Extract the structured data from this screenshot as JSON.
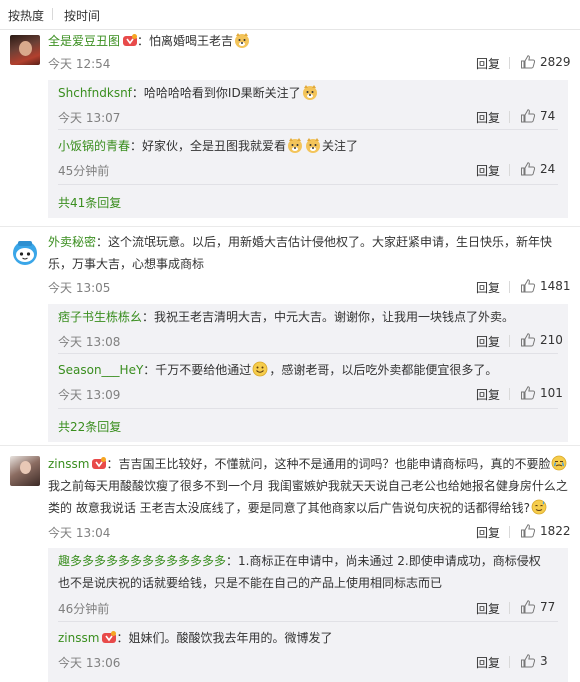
{
  "tabs": {
    "hot": "按热度",
    "time": "按时间"
  },
  "actions": {
    "reply": "回复"
  },
  "c1": {
    "user": "全是爱豆丑图",
    "text": "：怕离婚喝王老吉",
    "time": "今天 12:54",
    "likes": "2829",
    "replies": [
      {
        "user": "Shchfndksnf",
        "text": "：哈哈哈哈看到你ID果断关注了",
        "time": "今天 13:07",
        "likes": "74"
      },
      {
        "user": "小饭锅的青春",
        "text": "：好家伙，全是丑图我就爱看",
        "text2": "关注了",
        "time": "45分钟前",
        "likes": "24"
      }
    ],
    "more": "共41条回复"
  },
  "c2": {
    "user": "外卖秘密",
    "text": "：这个流氓玩意。以后，用新婚大吉估计侵他权了。大家赶紧申请，生日快乐，新年快",
    "text_line2": "乐，万事大吉，心想事成商标",
    "time": "今天 13:05",
    "likes": "1481",
    "replies": [
      {
        "user": "痞子书生栋栋幺",
        "text": "：我祝王老吉清明大吉，中元大吉。谢谢你，让我用一块钱点了外卖。",
        "time": "今天 13:08",
        "likes": "210"
      },
      {
        "user": "Season___HeY",
        "text": "：千万不要给他通过",
        "text2": "，感谢老哥，以后吃外卖都能便宜很多了。",
        "time": "今天 13:09",
        "likes": "101"
      }
    ],
    "more": "共22条回复"
  },
  "c3": {
    "user": "zinssm",
    "text": "：吉吉国王比较好，不懂就问，这种不是通用的词吗？也能申请商标吗，真的不要脸",
    "text_line2": "我之前每天用酸酸饮瘦了很多不到一个月 我闺蜜嫉妒我就天天说自己老公也给她报名健身房什么之",
    "text_line3": "类的 故意我说话 王老吉太没底线了，要是同意了其他商家以后广告说句庆祝的话都得给钱?",
    "time": "今天 13:04",
    "likes": "1822",
    "replies": [
      {
        "user": "趣多多多多多多多多多多多多多",
        "text": "：1.商标正在申请中，尚未通过 2.即使申请成功，商标侵权",
        "text_line2": "也不是说庆祝的话就要给钱，只是不能在自己的产品上使用相同标志而已",
        "time": "46分钟前",
        "likes": "77"
      },
      {
        "user": "zinssm",
        "text": "：姐妹们。酸酸饮我去年用的。微博发了",
        "time": "今天 13:06",
        "likes": "3"
      }
    ]
  },
  "colors": {
    "username": "#3a8e1f",
    "reply_bg": "#f2f2f5",
    "time": "#808080"
  }
}
